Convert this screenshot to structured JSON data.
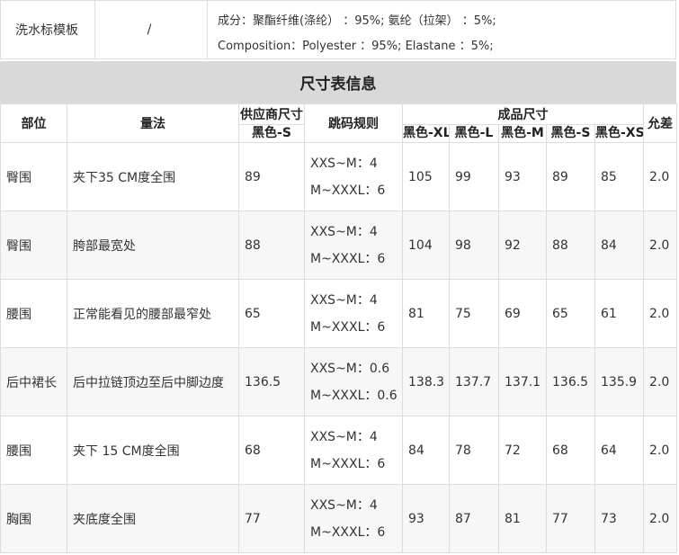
{
  "care_label": {
    "label": "洗水标模板",
    "value": "/",
    "composition_cn": "成分：聚酯纤维(涤纶）  ：95%; 氨纶（拉架）  ：5%;",
    "composition_en": "Composition：Polyester  ：95%; Elastane  ：5%;"
  },
  "section_title": "尺寸表信息",
  "table": {
    "headers": {
      "part": "部位",
      "method": "量法",
      "supplier_size": "供应商尺寸",
      "supplier_sub": "黑色-S",
      "grading": "跳码规则",
      "finished": "成品尺寸",
      "sizes": [
        "黑色-XL",
        "黑色-L",
        "黑色-M",
        "黑色-S",
        "黑色-XS"
      ],
      "tolerance": "允差"
    },
    "rows": [
      {
        "part": "臀围",
        "method": "夹下35 CM度全围",
        "supplier": "89",
        "rule1": "XXS~M：4",
        "rule2": "M~XXXL：6",
        "values": [
          "105",
          "99",
          "93",
          "89",
          "85"
        ],
        "tolerance": "2.0"
      },
      {
        "part": "臀围",
        "method": "胯部最宽处",
        "supplier": "88",
        "rule1": "XXS~M：4",
        "rule2": "M~XXXL：6",
        "values": [
          "104",
          "98",
          "92",
          "88",
          "84"
        ],
        "tolerance": "2.0"
      },
      {
        "part": "腰围",
        "method": "正常能看见的腰部最窄处",
        "supplier": "65",
        "rule1": "XXS~M：4",
        "rule2": "M~XXXL：6",
        "values": [
          "81",
          "75",
          "69",
          "65",
          "61"
        ],
        "tolerance": "2.0"
      },
      {
        "part": "后中裙长",
        "method": "后中拉链顶边至后中脚边度",
        "supplier": "136.5",
        "rule1": "XXS~M：0.6",
        "rule2": "M~XXXL：0.6",
        "values": [
          "138.3",
          "137.7",
          "137.1",
          "136.5",
          "135.9"
        ],
        "tolerance": "2.0"
      },
      {
        "part": "腰围",
        "method": "夹下 15 CM度全围",
        "supplier": "68",
        "rule1": "XXS~M：4",
        "rule2": "M~XXXL：6",
        "values": [
          "84",
          "78",
          "72",
          "68",
          "64"
        ],
        "tolerance": "2.0"
      },
      {
        "part": "胸围",
        "method": "夹底度全围",
        "supplier": "77",
        "rule1": "XXS~M：4",
        "rule2": "M~XXXL：6",
        "values": [
          "93",
          "87",
          "81",
          "77",
          "73"
        ],
        "tolerance": "2.0"
      }
    ]
  }
}
